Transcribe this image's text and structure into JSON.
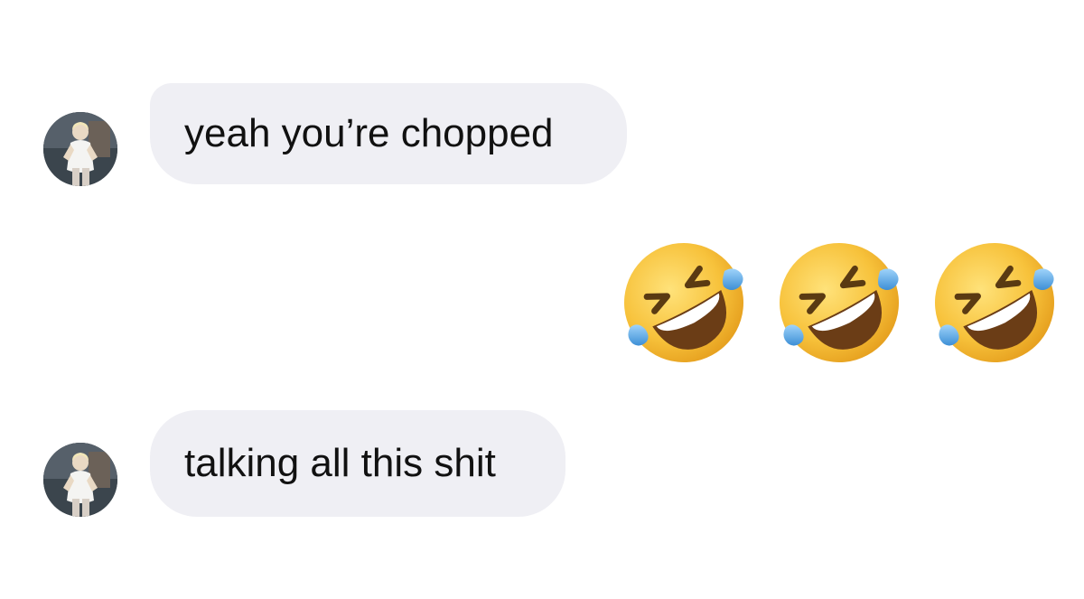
{
  "messages": [
    {
      "sender": "them",
      "text": "yeah you’re chopped",
      "avatar_icon": "person-photo-avatar"
    },
    {
      "sender": "me",
      "emoji": [
        "rolling-on-floor-laughing",
        "rolling-on-floor-laughing",
        "rolling-on-floor-laughing"
      ]
    },
    {
      "sender": "them",
      "text": "talking all this shit",
      "avatar_icon": "person-photo-avatar"
    }
  ],
  "colors": {
    "incoming_bubble": "#efeff4",
    "text": "#111111",
    "background": "#ffffff",
    "emoji_face": "#f7c23b",
    "emoji_tear": "#5aa9e6"
  }
}
